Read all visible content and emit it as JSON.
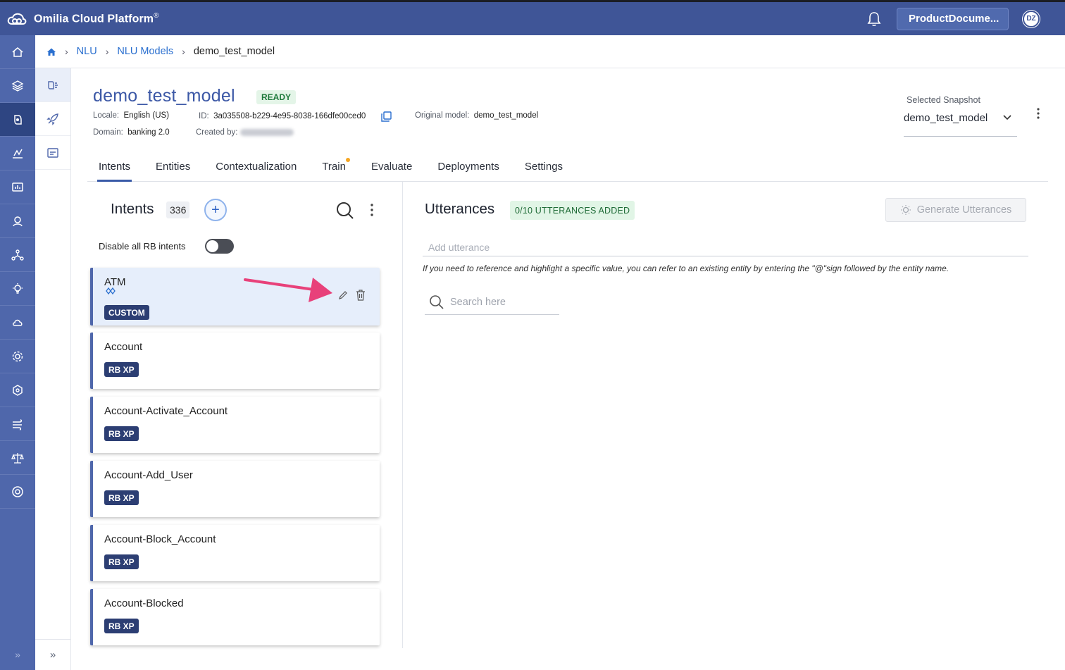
{
  "app": {
    "title": "Omilia Cloud Platform",
    "trademark": "®",
    "workspace": "ProductDocume...",
    "avatar_initials": "DZ"
  },
  "rail": {
    "icons": [
      "home-icon",
      "layers-icon",
      "nlu-icon",
      "analytics-icon",
      "monitor-icon",
      "agent-icon",
      "nodes-icon",
      "bulb-icon",
      "cloud-icon",
      "gear-icon",
      "hex-icon",
      "wind-icon",
      "scale-icon",
      "lifebuoy-icon"
    ],
    "active_index": 2
  },
  "subrail": {
    "icons": [
      "nlu-brain-icon",
      "rocket-icon",
      "test-icon"
    ],
    "active_index": 0
  },
  "breadcrumb": {
    "items": [
      "NLU",
      "NLU Models"
    ],
    "current": "demo_test_model"
  },
  "model": {
    "name": "demo_test_model",
    "status": "READY",
    "locale_label": "Locale:",
    "locale_value": "English (US)",
    "id_label": "ID:",
    "id_value": "3a035508-b229-4e95-8038-166dfe00ced0",
    "original_label": "Original model:",
    "original_value": "demo_test_model",
    "domain_label": "Domain:",
    "domain_value": "banking 2.0",
    "created_label": "Created by:"
  },
  "snapshot": {
    "label": "Selected Snapshot",
    "value": "demo_test_model"
  },
  "tabs": [
    {
      "label": "Intents",
      "active": true
    },
    {
      "label": "Entities"
    },
    {
      "label": "Contextualization"
    },
    {
      "label": "Train",
      "dot": true
    },
    {
      "label": "Evaluate"
    },
    {
      "label": "Deployments"
    },
    {
      "label": "Settings"
    }
  ],
  "intents": {
    "title": "Intents",
    "count": "336",
    "add_label": "+",
    "toggle_label": "Disable all RB intents",
    "toggle_on": false,
    "items": [
      {
        "name": "ATM",
        "tag": "CUSTOM",
        "selected": true
      },
      {
        "name": "Account",
        "tag": "RB XP"
      },
      {
        "name": "Account-Activate_Account",
        "tag": "RB XP"
      },
      {
        "name": "Account-Add_User",
        "tag": "RB XP"
      },
      {
        "name": "Account-Block_Account",
        "tag": "RB XP"
      },
      {
        "name": "Account-Blocked",
        "tag": "RB XP"
      }
    ]
  },
  "utterances": {
    "title": "Utterances",
    "badge": "0/10 UTTERANCES ADDED",
    "generate_label": "Generate Utterances",
    "input_placeholder": "Add utterance",
    "hint": "If you need to reference and highlight a specific value, you can refer to an existing entity by entering the \"@\"sign followed by the entity name.",
    "search_placeholder": "Search here"
  },
  "colors": {
    "topbar": "#3f5597",
    "rail": "#4f67ab",
    "accent": "#3a5ba8",
    "tag": "#2c3e73",
    "annotation_arrow": "#e8417a"
  }
}
